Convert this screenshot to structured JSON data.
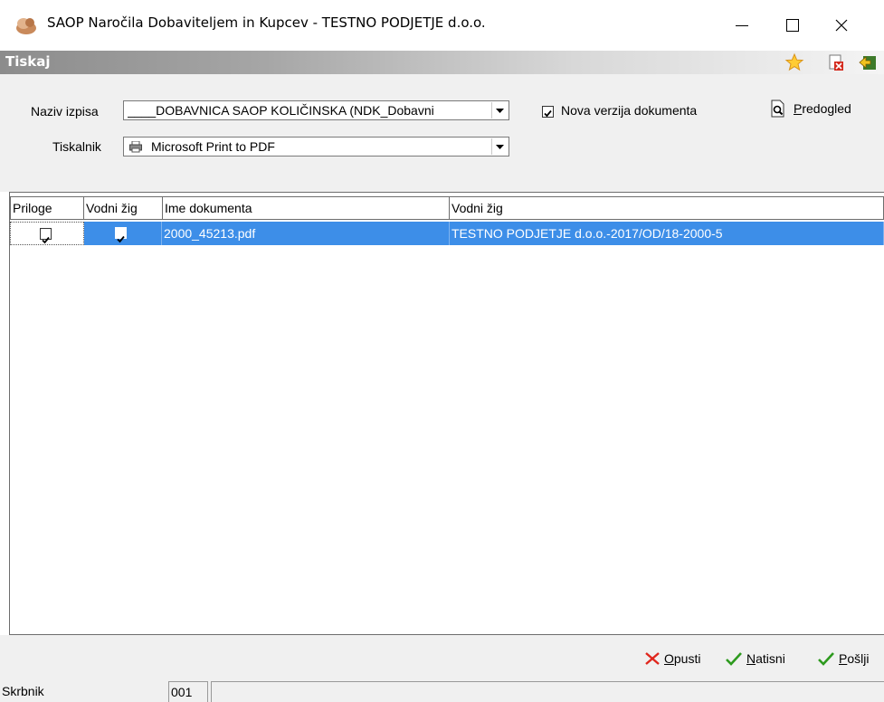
{
  "window": {
    "title": "SAOP   Naročila Dobaviteljem in Kupcev - TESTNO PODJETJE d.o.o."
  },
  "panel": {
    "title": "Tiskaj",
    "icons": [
      "star-icon",
      "delete-document-icon",
      "exit-icon"
    ]
  },
  "form": {
    "report_label": "Naziv izpisa",
    "report_value": "____DOBAVNICA SAOP KOLIČINSKA  (NDK_Dobavni",
    "printer_label": "Tiskalnik",
    "printer_value": "Microsoft Print to PDF",
    "new_version_label": "Nova verzija dokumenta",
    "new_version_checked": true,
    "preview_label": "Predogled"
  },
  "grid": {
    "columns": [
      "Priloge",
      "Vodni žig",
      "Ime dokumenta",
      "Vodni žig"
    ],
    "rows": [
      {
        "priloge": true,
        "vodni_zig": true,
        "ime": "2000_45213.pdf",
        "vodni_zig_text": "TESTNO PODJETJE d.o.o.-2017/OD/18-2000-5"
      }
    ]
  },
  "actions": {
    "cancel": "Opusti",
    "print": "Natisni",
    "send": "Pošlji"
  },
  "status": {
    "user": "Skrbnik",
    "code": "001"
  }
}
